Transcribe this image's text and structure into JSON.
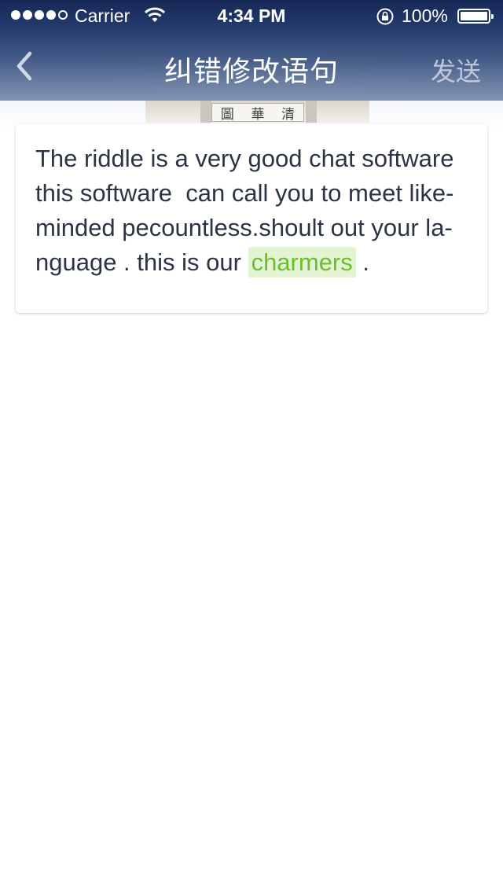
{
  "status_bar": {
    "carrier": "Carrier",
    "time": "4:34 PM",
    "battery": "100%"
  },
  "nav": {
    "title": "纠错修改语句",
    "send_label": "发送",
    "back_icon": "chevron-left-icon"
  },
  "background": {
    "plaque_chars": [
      "圖",
      "華",
      "清"
    ]
  },
  "sentence": {
    "lines": [
      "The riddle is a very good chat software",
      "this software  can call you to meet like-",
      "minded pecountless.shoult out your la-",
      "nguage . this is our "
    ],
    "highlight": "charmers",
    "tail": " ."
  },
  "colors": {
    "highlight_text": "#6bbf2e",
    "highlight_bg": "#e4f3d3",
    "nav_bg": "#243e78"
  }
}
